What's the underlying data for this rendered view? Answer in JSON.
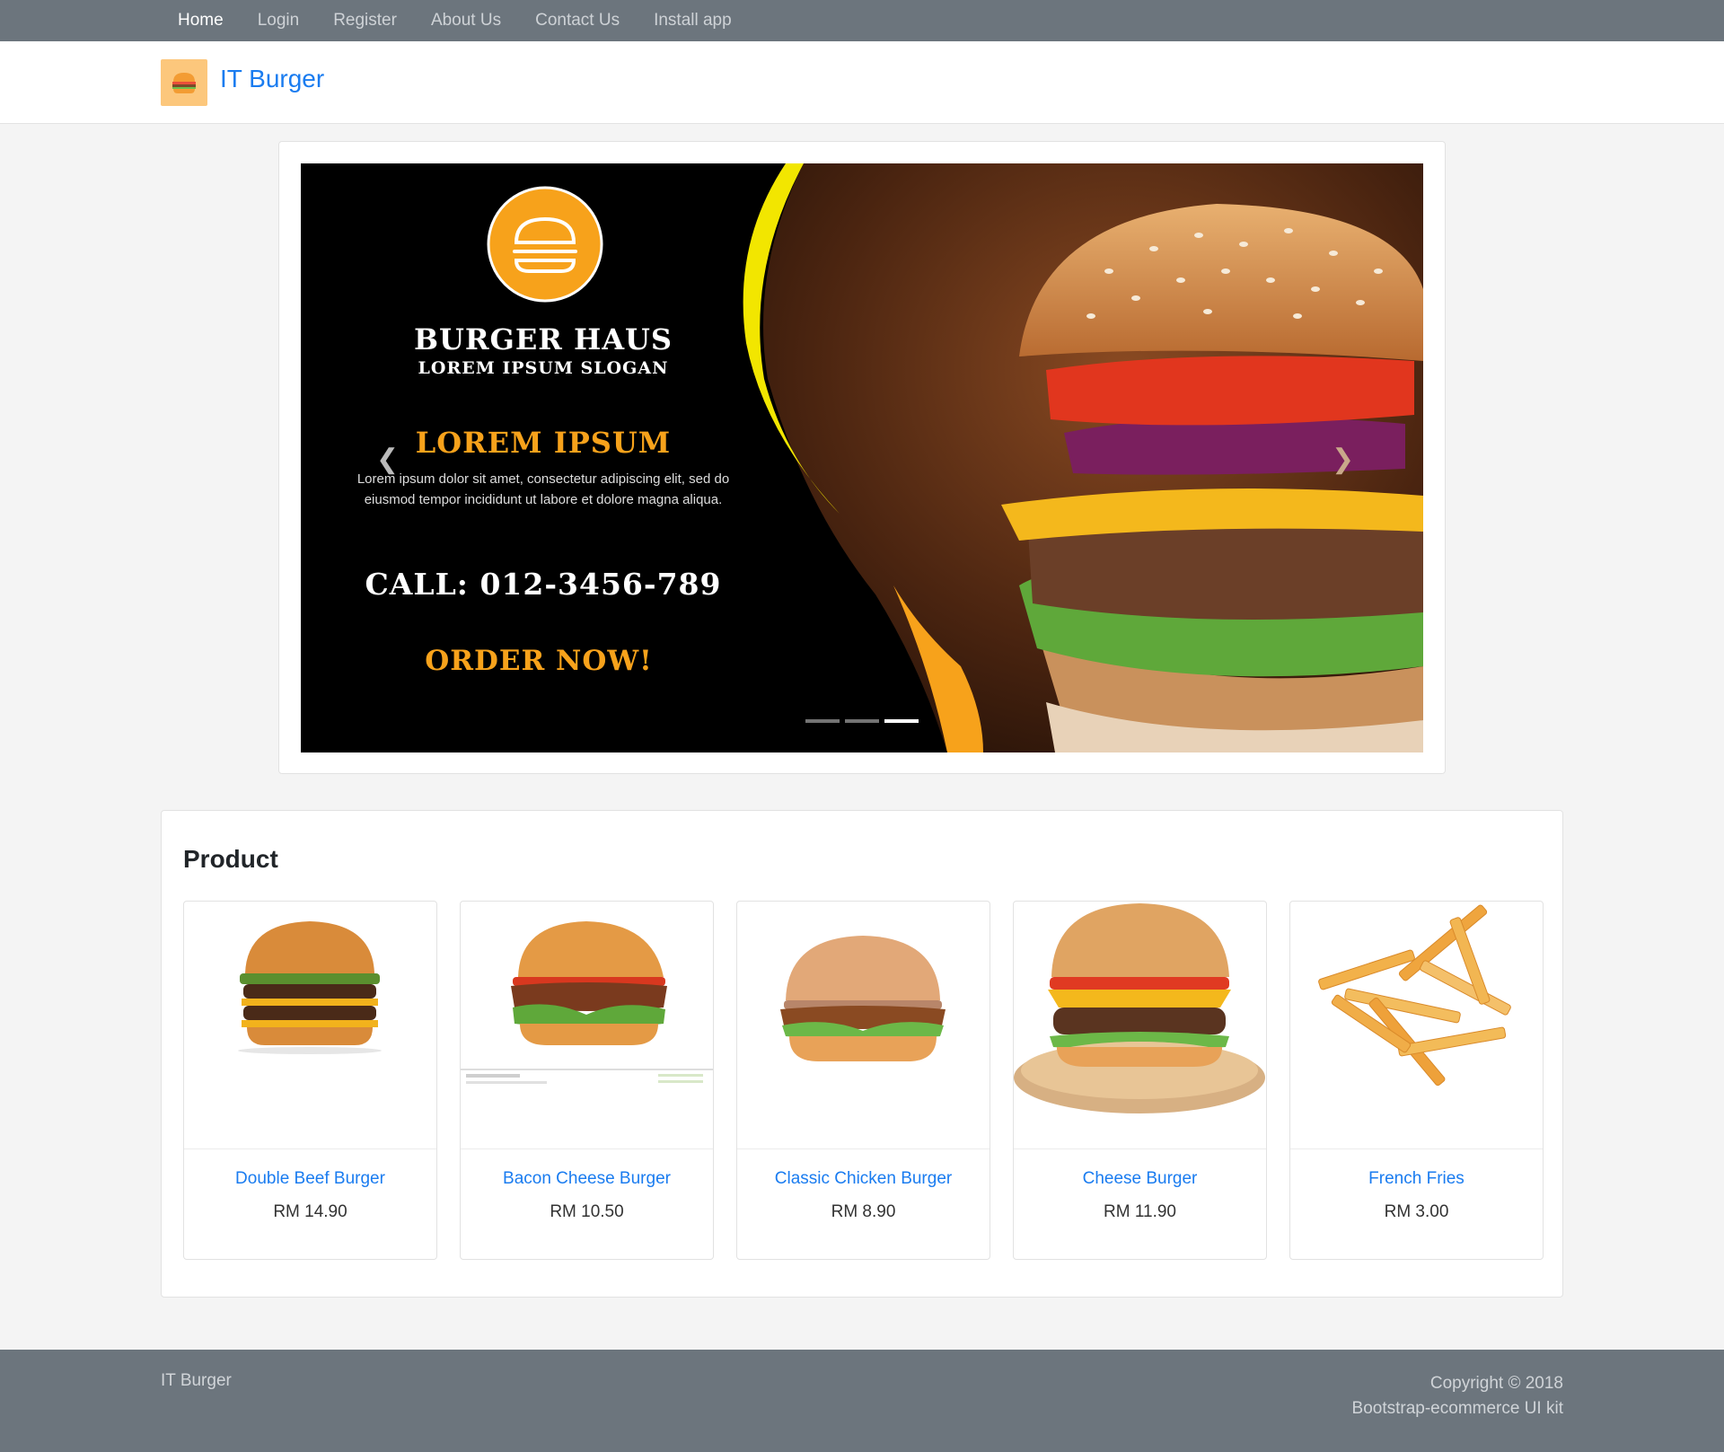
{
  "nav": {
    "items": [
      {
        "label": "Home",
        "active": true
      },
      {
        "label": "Login",
        "active": false
      },
      {
        "label": "Register",
        "active": false
      },
      {
        "label": "About Us",
        "active": false
      },
      {
        "label": "Contact Us",
        "active": false
      },
      {
        "label": "Install app",
        "active": false
      }
    ]
  },
  "header": {
    "logo_icon": "burger-icon",
    "brand": "IT Burger"
  },
  "slider": {
    "title": "BURGER HAUS",
    "slogan": "LOREM IPSUM SLOGAN",
    "headline": "LOREM IPSUM",
    "body": "Lorem ipsum dolor sit amet, consectetur adipiscing elit, sed do eiusmod tempor incididunt ut labore et dolore magna aliqua.",
    "call": "CALL: 012-3456-789",
    "order": "ORDER NOW!",
    "prev_icon": "chevron-left-icon",
    "next_icon": "chevron-right-icon",
    "slide_count": 3,
    "active_slide": 3
  },
  "products": {
    "heading": "Product",
    "items": [
      {
        "name": "Double Beef Burger",
        "price": "RM 14.90",
        "icon": "double-burger-image"
      },
      {
        "name": "Bacon Cheese Burger",
        "price": "RM 10.50",
        "icon": "bacon-burger-image"
      },
      {
        "name": "Classic Chicken Burger",
        "price": "RM 8.90",
        "icon": "chicken-burger-image"
      },
      {
        "name": "Cheese Burger",
        "price": "RM 11.90",
        "icon": "cheese-burger-image"
      },
      {
        "name": "French Fries",
        "price": "RM 3.00",
        "icon": "fries-image"
      }
    ]
  },
  "footer": {
    "brand": "IT Burger",
    "copyright": "Copyright © 2018",
    "kit": "Bootstrap-ecommerce UI kit"
  },
  "colors": {
    "nav_bg": "#6c757d",
    "link": "#1a7cf0",
    "accent_yellow": "#f7e600",
    "accent_orange": "#f7a21b"
  }
}
